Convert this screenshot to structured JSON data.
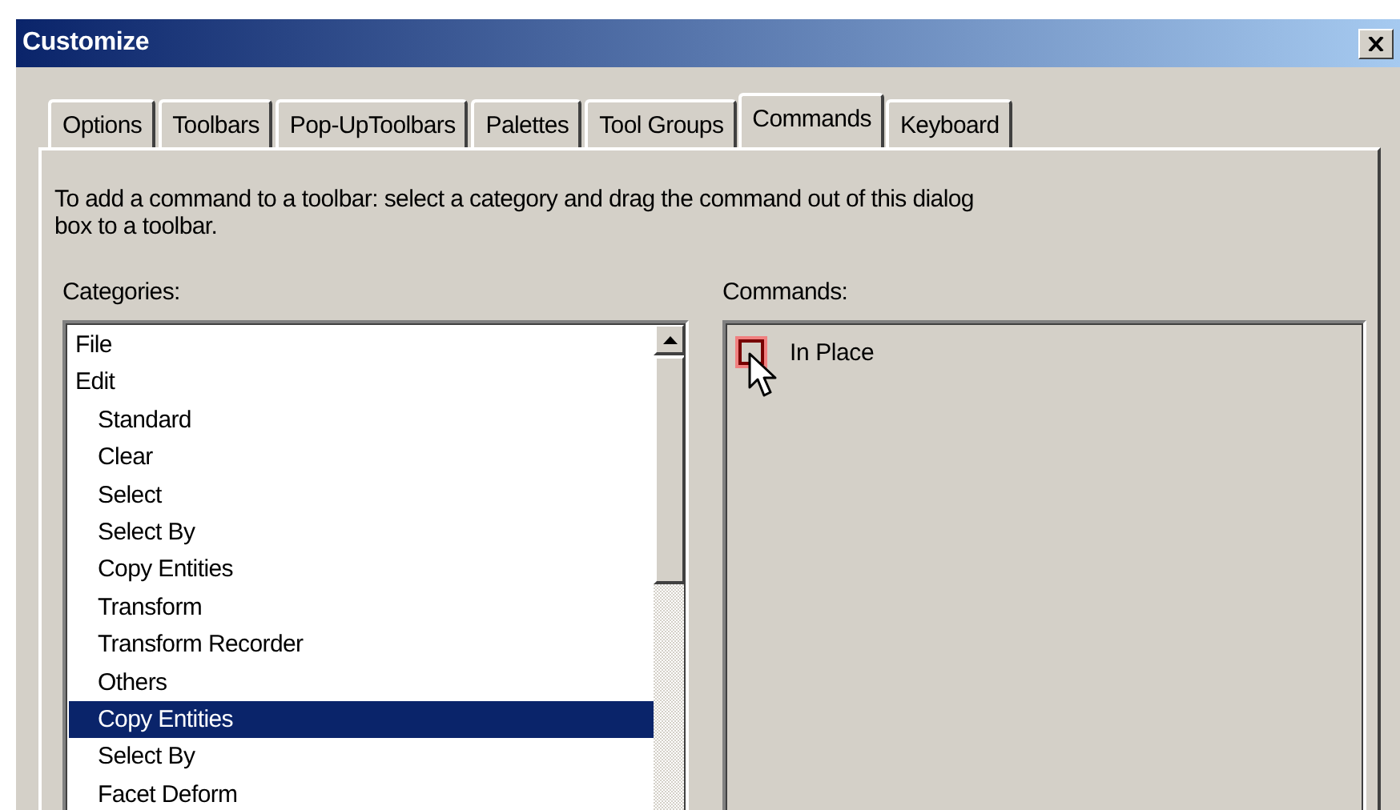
{
  "window": {
    "title": "Customize"
  },
  "tabs": [
    {
      "label": "Options",
      "selected": false
    },
    {
      "label": "Toolbars",
      "selected": false
    },
    {
      "label": "Pop-UpToolbars",
      "selected": false
    },
    {
      "label": "Palettes",
      "selected": false
    },
    {
      "label": "Tool Groups",
      "selected": false
    },
    {
      "label": "Commands",
      "selected": true
    },
    {
      "label": "Keyboard",
      "selected": false
    }
  ],
  "instructions": "To add a command to a toolbar: select a category and drag the command out of this dialog box to a toolbar.",
  "categories": {
    "label": "Categories:",
    "items": [
      {
        "label": "File",
        "selected": false
      },
      {
        "label": "Edit",
        "selected": false,
        "children": [
          {
            "label": "Standard",
            "selected": false
          },
          {
            "label": "Clear",
            "selected": false
          },
          {
            "label": "Select",
            "selected": false
          },
          {
            "label": "Select By",
            "selected": false
          },
          {
            "label": "Copy Entities",
            "selected": false
          },
          {
            "label": "Transform",
            "selected": false
          },
          {
            "label": "Transform Recorder",
            "selected": false
          },
          {
            "label": "Others",
            "selected": false
          },
          {
            "label": "Copy Entities",
            "selected": true
          },
          {
            "label": "Select By",
            "selected": false
          },
          {
            "label": "Facet Deform",
            "selected": false
          }
        ]
      }
    ]
  },
  "commands": {
    "label": "Commands:",
    "items": [
      {
        "label": "In Place"
      }
    ]
  }
}
